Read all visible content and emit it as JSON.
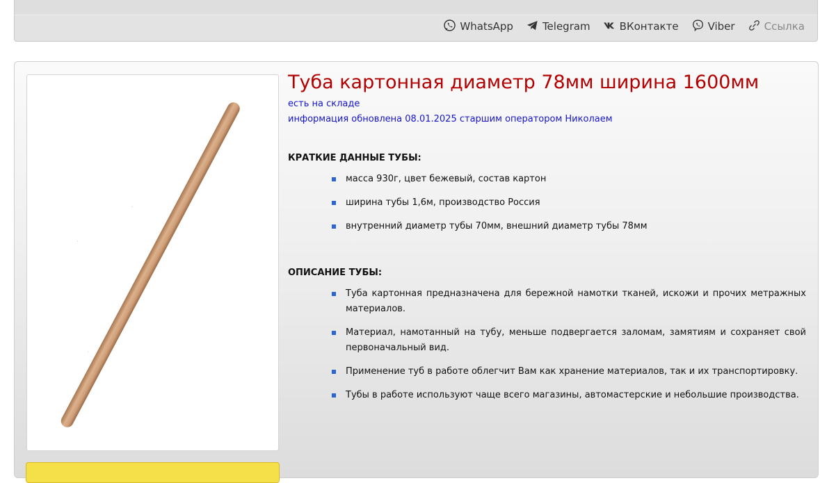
{
  "share": {
    "whatsapp": "WhatsApp",
    "telegram": "Telegram",
    "vkontakte": "ВКонтакте",
    "viber": "Viber",
    "link": "Ссылка"
  },
  "product": {
    "title": "Туба картонная диаметр 78мм ширина 1600мм",
    "stock": "есть на складе",
    "updated": "информация обновлена 08.01.2025 старшим оператором Николаем",
    "short_heading": "КРАТКИЕ ДАННЫЕ ТУБЫ:",
    "short_points": [
      "масса 930г, цвет бежевый, состав картон",
      "ширина тубы 1,6м, производство Россия",
      "внутренний диаметр тубы 70мм, внешний диаметр тубы 78мм"
    ],
    "desc_heading": "ОПИСАНИЕ ТУБЫ:",
    "desc_points": [
      "Туба картонная предназначена для бережной намотки тканей, искожи и прочих метражных материалов.",
      "Материал, намотанный на тубу, меньше подвергается заломам, замятиям и сохраняет свой первоначальный вид.",
      "Применение туб в работе облегчит Вам как хранение материалов, так и их транспортировку.",
      "Тубы в работе используют чаще всего магазины, автомастерские и небольшие производства."
    ]
  },
  "icons": {
    "whatsapp": "whatsapp-icon",
    "telegram": "telegram-icon",
    "vkontakte": "vk-icon",
    "viber": "viber-icon",
    "link": "link-icon"
  },
  "colors": {
    "title": "#b30000",
    "info_text": "#1515cc",
    "bullet": "#2a64d8",
    "buy_strip": "#f6e04a"
  }
}
